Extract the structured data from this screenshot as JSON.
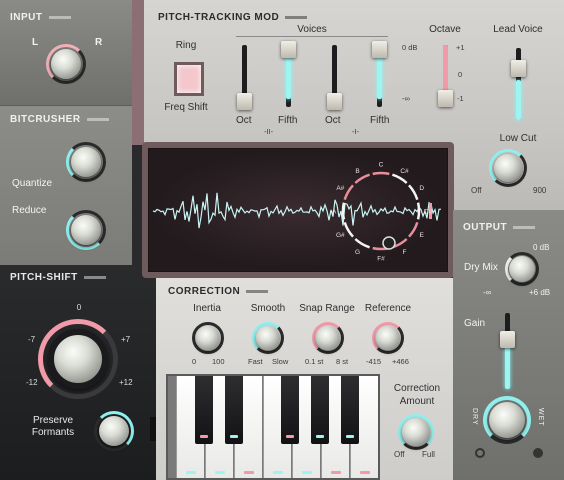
{
  "input": {
    "title": "INPUT",
    "left": "L",
    "right": "R"
  },
  "bitcrusher": {
    "title": "BITCRUSHER",
    "quantize": "Quantize",
    "reduce": "Reduce"
  },
  "pitch_shift": {
    "title": "PITCH-SHIFT",
    "scale": [
      "0",
      "+7",
      "+12",
      "-12",
      "-7"
    ],
    "preserve": "Preserve Formants"
  },
  "pitch_tracking": {
    "title": "PITCH-TRACKING MOD",
    "ring": "Ring",
    "freq_shift": "Freq Shift",
    "voices": "Voices",
    "octave": "Octave",
    "lead_voice": "Lead Voice",
    "db0": "0 dB",
    "dbinf": "-∞",
    "oct_scale": [
      "+1",
      "0",
      "-1"
    ],
    "groups": [
      "-II-",
      "-I-"
    ],
    "slider_labels": [
      "Oct",
      "Fifth",
      "Oct",
      "Fifth"
    ],
    "slider_levels": [
      0.0,
      0.45,
      0.0,
      0.48
    ],
    "octave_level": 0.5,
    "low_cut": "Low Cut",
    "low_cut_min": "Off",
    "low_cut_max": "900"
  },
  "tuner": {
    "notes": [
      "C",
      "C#",
      "D",
      "D#",
      "E",
      "F",
      "F#",
      "G",
      "G#",
      "A",
      "A#",
      "B"
    ]
  },
  "correction": {
    "title": "CORRECTION",
    "inertia": "Inertia",
    "inertia_min": "0",
    "inertia_max": "100",
    "smooth": "Smooth",
    "smooth_min": "Fast",
    "smooth_max": "Slow",
    "snap": "Snap Range",
    "snap_min": "0.1 st",
    "snap_max": "8 st",
    "reference": "Reference",
    "ref_min": "-415",
    "ref_max": "+466",
    "amount": "Correction Amount",
    "amount_min": "Off",
    "amount_max": "Full"
  },
  "output": {
    "title": "OUTPUT",
    "db0": "0 dB",
    "dry_mix": "Dry Mix",
    "min": "-∞",
    "max": "+6 dB",
    "gain": "Gain",
    "dry": "DRY",
    "wet": "WET",
    "gain_level": 0.7
  }
}
